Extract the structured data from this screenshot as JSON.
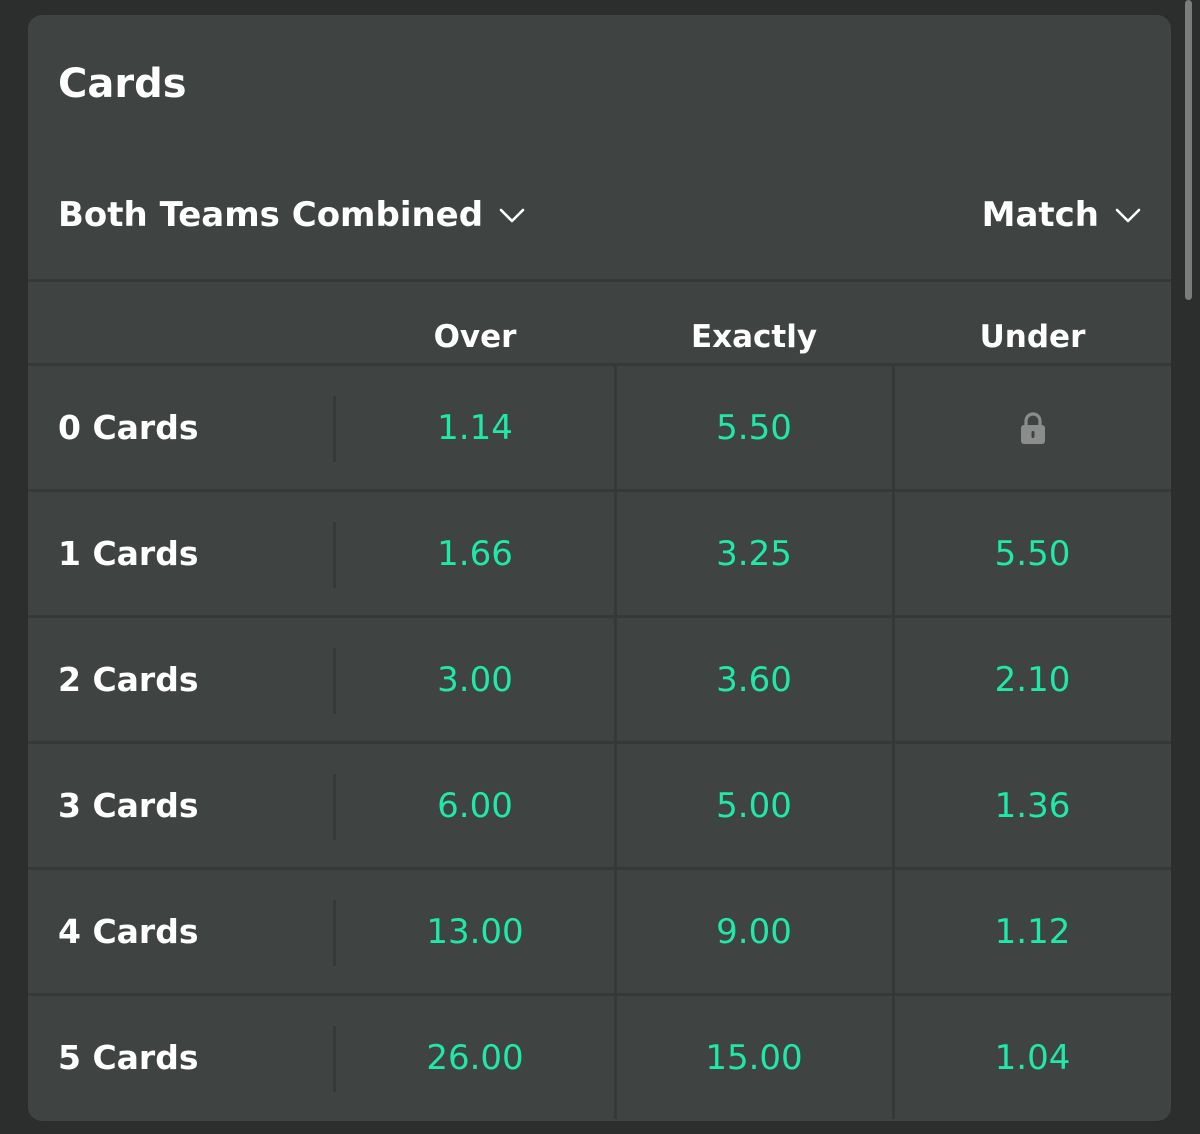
{
  "market": {
    "title": "Cards"
  },
  "filters": {
    "scope_label": "Both Teams Combined",
    "period_label": "Match"
  },
  "columns": [
    "Over",
    "Exactly",
    "Under"
  ],
  "rows": [
    {
      "label": "0 Cards",
      "over": "1.14",
      "exactly": "5.50",
      "under": null,
      "under_locked": true
    },
    {
      "label": "1 Cards",
      "over": "1.66",
      "exactly": "3.25",
      "under": "5.50",
      "under_locked": false
    },
    {
      "label": "2 Cards",
      "over": "3.00",
      "exactly": "3.60",
      "under": "2.10",
      "under_locked": false
    },
    {
      "label": "3 Cards",
      "over": "6.00",
      "exactly": "5.00",
      "under": "1.36",
      "under_locked": false
    },
    {
      "label": "4 Cards",
      "over": "13.00",
      "exactly": "9.00",
      "under": "1.12",
      "under_locked": false
    },
    {
      "label": "5 Cards",
      "over": "26.00",
      "exactly": "15.00",
      "under": "1.04",
      "under_locked": false
    }
  ],
  "icons": {
    "dropdown": "chevron-down-icon",
    "locked": "lock-icon"
  },
  "colors": {
    "panel": "#3f4442",
    "background": "#2b2e2d",
    "odds": "#1fe8a8",
    "text": "#ffffff",
    "lock": "#8a8d8c"
  }
}
